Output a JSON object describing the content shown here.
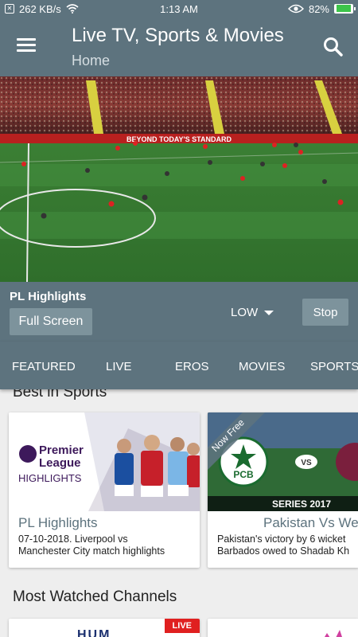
{
  "status_bar": {
    "speed": "262 KB/s",
    "time": "1:13 AM",
    "battery": "82%",
    "icons": [
      "notification-icon",
      "wifi-icon",
      "eye-icon",
      "battery-icon"
    ]
  },
  "app_bar": {
    "title": "Live TV, Sports & Movies",
    "subtitle": "Home"
  },
  "video": {
    "banner_text": "BEYOND TODAY'S STANDARD"
  },
  "player": {
    "title": "PL Highlights",
    "full_screen_label": "Full Screen",
    "quality": "LOW",
    "stop_label": "Stop"
  },
  "tabs": [
    "FEATURED",
    "LIVE",
    "EROS",
    "MOVIES",
    "SPORTS"
  ],
  "sections": {
    "best_in_sports": "Best in Sports",
    "most_watched": "Most Watched Channels"
  },
  "cards": [
    {
      "logo_line1": "Premier",
      "logo_line2": "League",
      "logo_line3": "HIGHLIGHTS",
      "title": "PL Highlights",
      "desc": "07-10-2018. Liverpool vs\nManchester City match highlights"
    },
    {
      "ribbon": "Now Free",
      "logo": "PCB",
      "vs": "VS",
      "series": "SERIES 2017",
      "title": "Pakistan Vs We",
      "desc": "Pakistan's victory by 6 wicket\nBarbados owed to Shadab Kh"
    }
  ],
  "channels": [
    {
      "logo_text": "HUM",
      "badge": "LIVE"
    }
  ],
  "colors": {
    "primary": "#5d737e",
    "button": "#7d939c",
    "live_red": "#e02020",
    "pitch": "#3f8a3a"
  }
}
